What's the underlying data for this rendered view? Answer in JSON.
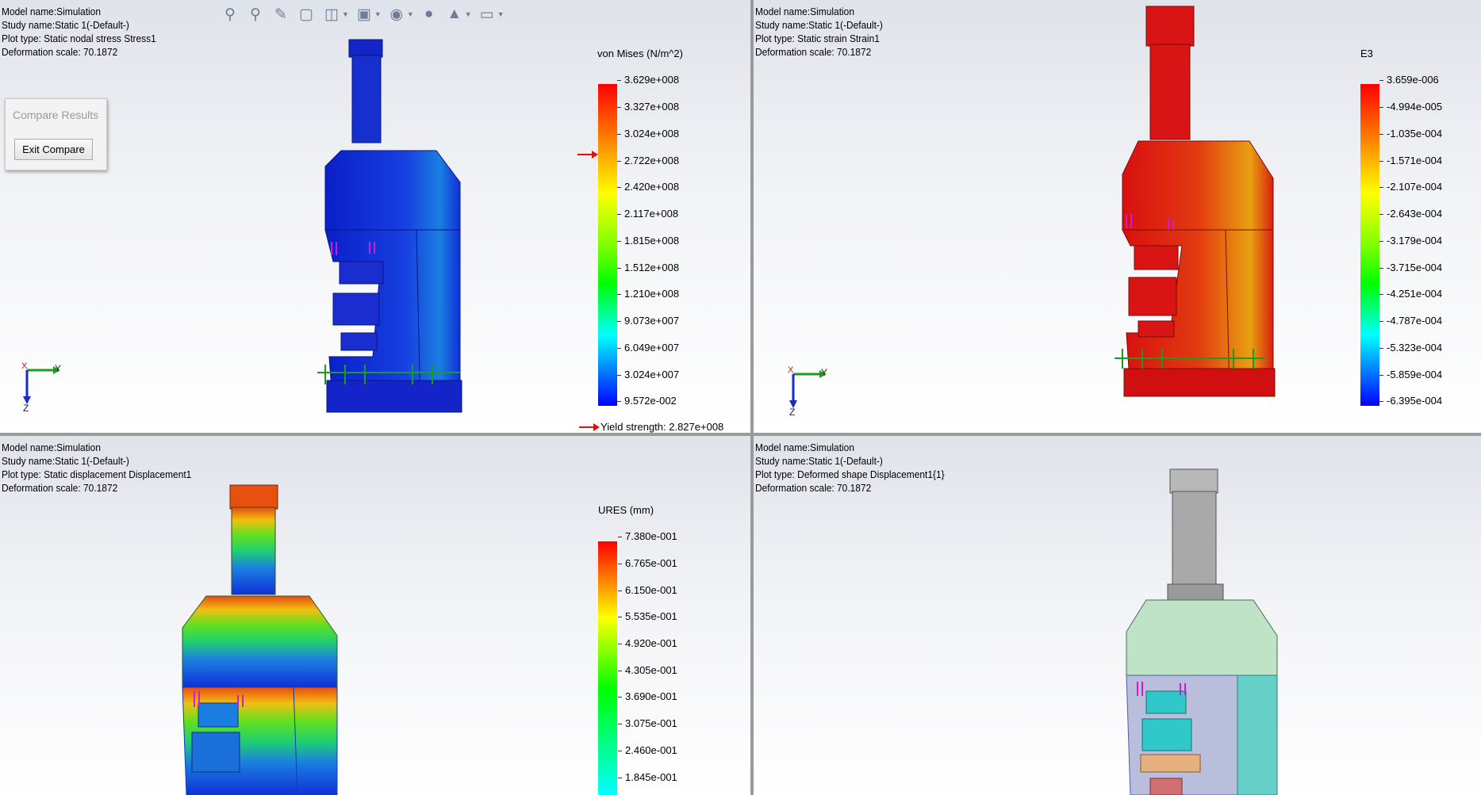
{
  "toolbar": {
    "icons": [
      "zoom-to-fit-icon",
      "zoom-to-area-icon",
      "previous-view-icon",
      "section-view-icon",
      "view-orientation-icon",
      "display-style-icon",
      "hide-show-items-icon",
      "edit-appearance-icon",
      "apply-scene-icon",
      "view-settings-icon"
    ]
  },
  "compare": {
    "title": "Compare Results",
    "exit_label": "Exit Compare"
  },
  "viewports": {
    "top_left": {
      "info": [
        "Model name:Simulation",
        "Study name:Static 1(-Default-)",
        "Plot type: Static nodal stress Stress1",
        "Deformation scale: 70.1872"
      ],
      "legend_title": "von Mises (N/m^2)",
      "ticks": [
        "3.629e+008",
        "3.327e+008",
        "3.024e+008",
        "2.722e+008",
        "2.420e+008",
        "2.117e+008",
        "1.815e+008",
        "1.512e+008",
        "1.210e+008",
        "9.073e+007",
        "6.049e+007",
        "3.024e+007",
        "9.572e-002"
      ],
      "yield": "Yield strength: 2.827e+008",
      "triad": {
        "x": "X",
        "y": "Y",
        "z": "Z"
      }
    },
    "top_right": {
      "info": [
        "Model name:Simulation",
        "Study name:Static 1(-Default-)",
        "Plot type: Static strain Strain1",
        "Deformation scale: 70.1872"
      ],
      "legend_title": "E3",
      "ticks": [
        "3.659e-006",
        "-4.994e-005",
        "-1.035e-004",
        "-1.571e-004",
        "-2.107e-004",
        "-2.643e-004",
        "-3.179e-004",
        "-3.715e-004",
        "-4.251e-004",
        "-4.787e-004",
        "-5.323e-004",
        "-5.859e-004",
        "-6.395e-004"
      ],
      "triad": {
        "x": "X",
        "y": "Y",
        "z": "Z"
      }
    },
    "bottom_left": {
      "info": [
        "Model name:Simulation",
        "Study name:Static 1(-Default-)",
        "Plot type: Static displacement Displacement1",
        "Deformation scale: 70.1872"
      ],
      "legend_title": "URES (mm)",
      "ticks": [
        "7.380e-001",
        "6.765e-001",
        "6.150e-001",
        "5.535e-001",
        "4.920e-001",
        "4.305e-001",
        "3.690e-001",
        "3.075e-001",
        "2.460e-001",
        "1.845e-001"
      ]
    },
    "bottom_right": {
      "info": [
        "Model name:Simulation",
        "Study name:Static 1(-Default-)",
        "Plot type: Deformed shape Displacement1{1}",
        "Deformation scale: 70.1872"
      ]
    }
  },
  "colors": {
    "stress_body": "#1b2fd6",
    "strain_body": "#d81212",
    "fixture_green": "#1f9a1f",
    "load_magenta": "#d21ad2",
    "yield_arrow": "#e01010"
  }
}
